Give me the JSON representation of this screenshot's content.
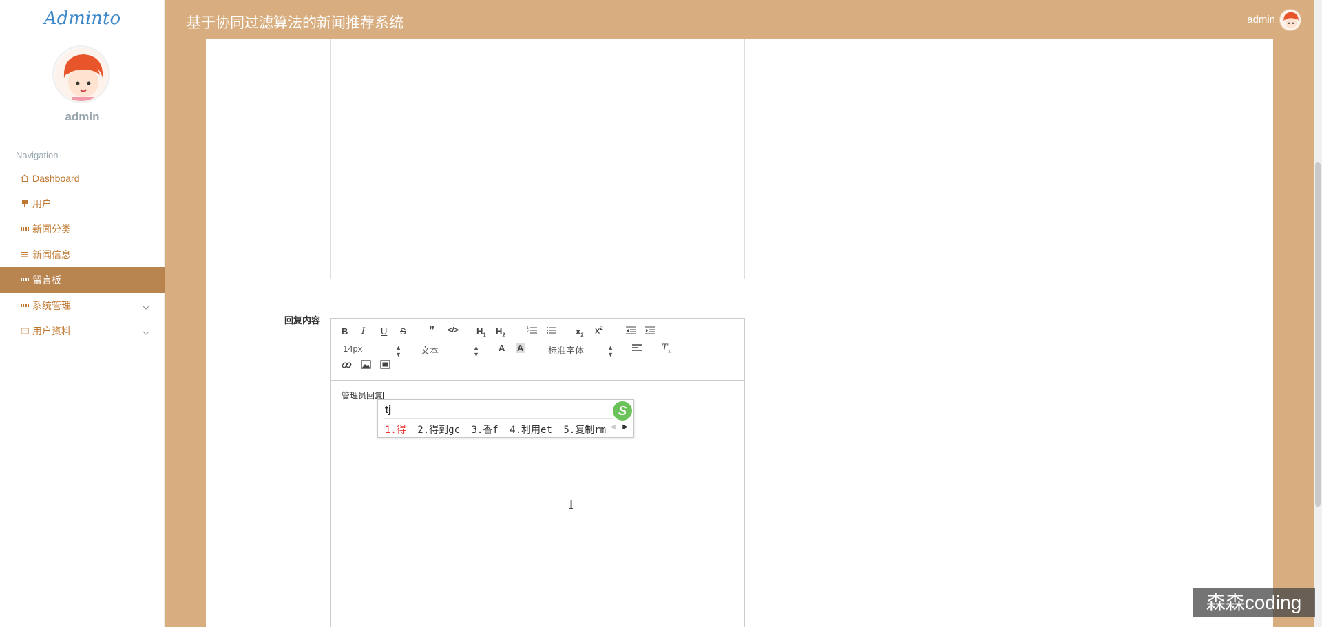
{
  "app": {
    "logo": "Adminto",
    "system_title": "基于协同过滤算法的新闻推荐系统",
    "user_name": "admin"
  },
  "sidebar": {
    "user_name": "admin",
    "nav_title": "Navigation",
    "items": [
      {
        "label": "Dashboard",
        "icon": "home-icon"
      },
      {
        "label": "用户",
        "icon": "pin-icon"
      },
      {
        "label": "新闻分类",
        "icon": "grid-icon"
      },
      {
        "label": "新闻信息",
        "icon": "list-icon"
      },
      {
        "label": "留言板",
        "icon": "grid-icon",
        "active": true
      },
      {
        "label": "系统管理",
        "icon": "grid-icon",
        "expandable": true
      },
      {
        "label": "用户资料",
        "icon": "card-icon",
        "expandable": true
      }
    ]
  },
  "form": {
    "reply_label": "回复内容",
    "editor": {
      "font_size": "14px",
      "text_type": "文本",
      "font_family": "标准字体",
      "content": "管理员回复"
    }
  },
  "ime": {
    "input": "tj",
    "candidates": [
      "1.得",
      "2.得到gc",
      "3.香f",
      "4.利用et",
      "5.复制rm"
    ]
  },
  "watermark": "森森coding",
  "colors": {
    "topbar": "#d8ad7f",
    "active_nav": "#b88450",
    "nav_text": "#c07830"
  }
}
